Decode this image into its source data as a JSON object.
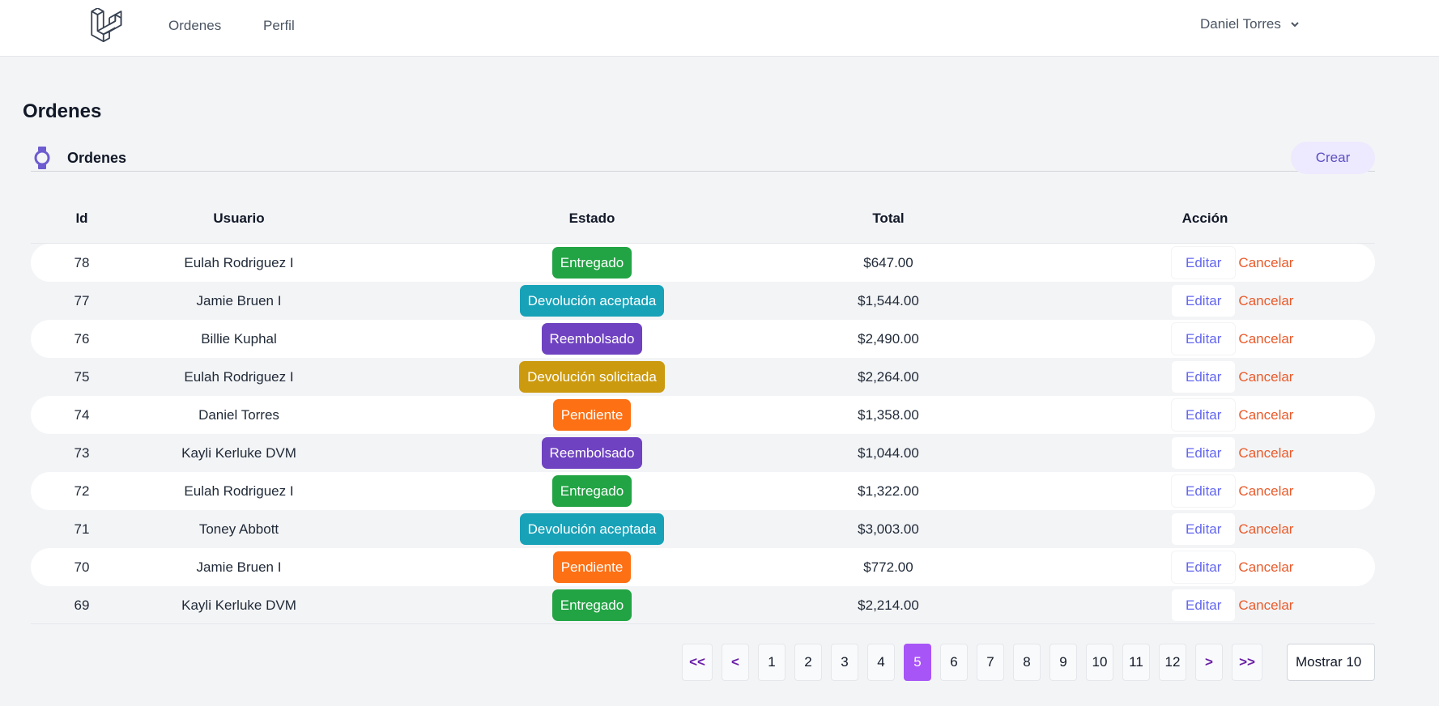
{
  "nav": {
    "links": [
      "Ordenes",
      "Perfil"
    ],
    "user_name": "Daniel Torres",
    "logo_icon": "laravel-logo-icon",
    "dropdown_icon": "chevron-down-icon"
  },
  "page": {
    "title": "Ordenes"
  },
  "section": {
    "title": "Ordenes",
    "icon": "watch-icon",
    "create_label": "Crear"
  },
  "table": {
    "headers": [
      "Id",
      "Usuario",
      "Estado",
      "Total",
      "Acción"
    ],
    "edit_label": "Editar",
    "cancel_label": "Cancelar",
    "rows": [
      {
        "id": "78",
        "user": "Eulah Rodriguez I",
        "status": "Entregado",
        "status_color": "#22a444",
        "total": "$647.00"
      },
      {
        "id": "77",
        "user": "Jamie Bruen I",
        "status": "Devolución aceptada",
        "status_color": "#17a2b8",
        "total": "$1,544.00"
      },
      {
        "id": "76",
        "user": "Billie Kuphal",
        "status": "Reembolsado",
        "status_color": "#6f42c1",
        "total": "$2,490.00"
      },
      {
        "id": "75",
        "user": "Eulah Rodriguez I",
        "status": "Devolución solicitada",
        "status_color": "#cc9a0f",
        "total": "$2,264.00"
      },
      {
        "id": "74",
        "user": "Daniel Torres",
        "status": "Pendiente",
        "status_color": "#fd7014",
        "total": "$1,358.00"
      },
      {
        "id": "73",
        "user": "Kayli Kerluke DVM",
        "status": "Reembolsado",
        "status_color": "#6f42c1",
        "total": "$1,044.00"
      },
      {
        "id": "72",
        "user": "Eulah Rodriguez I",
        "status": "Entregado",
        "status_color": "#22a444",
        "total": "$1,322.00"
      },
      {
        "id": "71",
        "user": "Toney Abbott",
        "status": "Devolución aceptada",
        "status_color": "#17a2b8",
        "total": "$3,003.00"
      },
      {
        "id": "70",
        "user": "Jamie Bruen I",
        "status": "Pendiente",
        "status_color": "#fd7014",
        "total": "$772.00"
      },
      {
        "id": "69",
        "user": "Kayli Kerluke DVM",
        "status": "Entregado",
        "status_color": "#22a444",
        "total": "$2,214.00"
      }
    ]
  },
  "pagination": {
    "first_label": "<<",
    "prev_label": "<",
    "pages": [
      "1",
      "2",
      "3",
      "4",
      "5",
      "6",
      "7",
      "8",
      "9",
      "10",
      "11",
      "12"
    ],
    "current_page": "5",
    "next_label": ">",
    "last_label": ">>",
    "per_page_label": "Mostrar 10",
    "accent_color": "#a855f7"
  }
}
